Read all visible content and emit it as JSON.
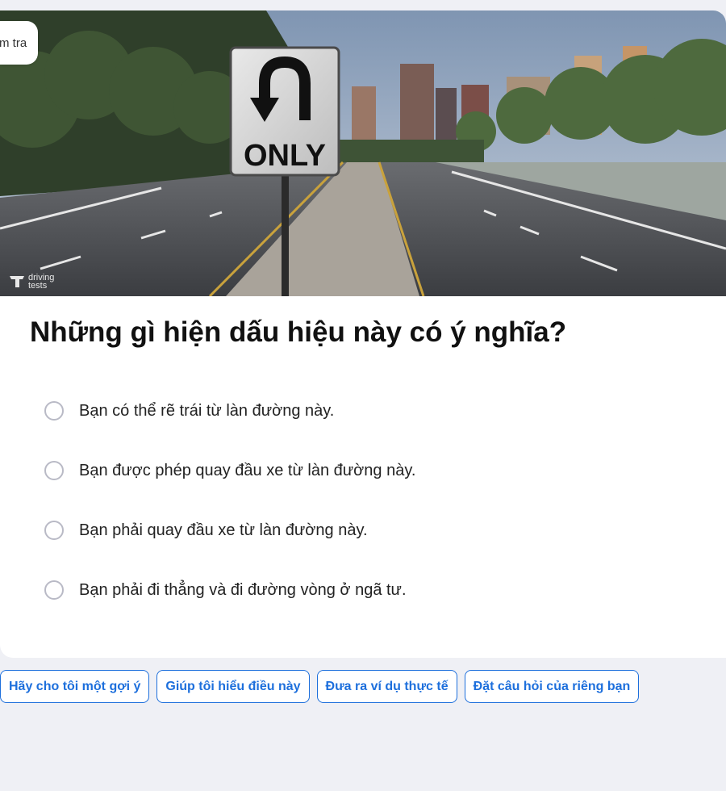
{
  "top_tag": {
    "text": "m tra"
  },
  "image": {
    "sign_text": "ONLY",
    "watermark_line1": "driving",
    "watermark_line2": "tests"
  },
  "question": "Những gì hiện dấu hiệu này có ý nghĩa?",
  "options": [
    {
      "label": "Bạn có thể rẽ trái từ làn đường này."
    },
    {
      "label": "Bạn được phép quay đầu xe từ làn đường này."
    },
    {
      "label": "Bạn phải quay đầu xe từ làn đường này."
    },
    {
      "label": "Bạn phải đi thẳng và đi đường vòng ở ngã tư."
    }
  ],
  "chips": [
    {
      "label": "Hãy cho tôi một gợi ý"
    },
    {
      "label": "Giúp tôi hiểu điều này"
    },
    {
      "label": "Đưa ra ví dụ thực tế"
    },
    {
      "label": "Đặt câu hỏi của riêng bạn"
    }
  ],
  "colors": {
    "accent": "#1d6fdc",
    "page_bg": "#eff0f5",
    "radio_border": "#b9bac6"
  }
}
